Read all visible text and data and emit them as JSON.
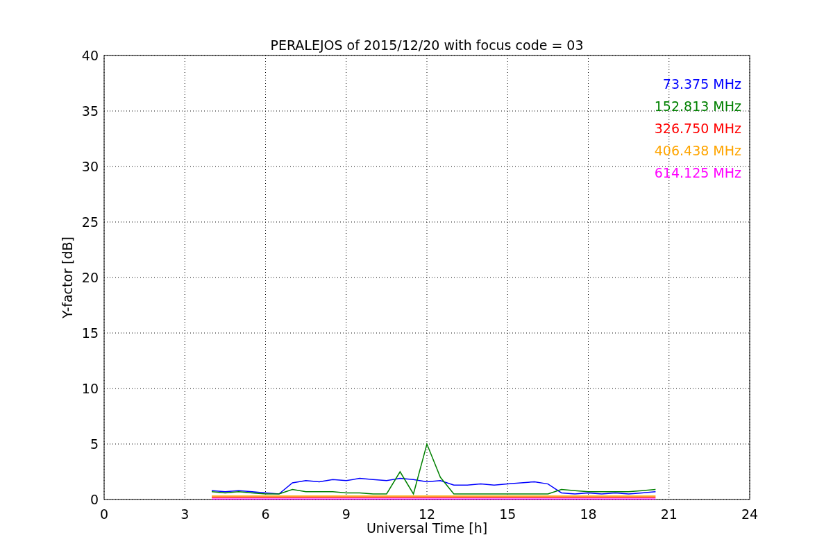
{
  "chart_data": {
    "type": "line",
    "grid": true,
    "title": "PERALEJOS of 2015/12/20 with focus code = 03",
    "xlabel": "Universal Time [h]",
    "ylabel": "Y-factor [dB]",
    "x": [
      4,
      4.5,
      5,
      5.5,
      6,
      6.5,
      7,
      7.5,
      8,
      8.5,
      9,
      9.5,
      10,
      10.5,
      11,
      11.5,
      12,
      12.5,
      13,
      13.5,
      14,
      14.5,
      15,
      15.5,
      16,
      16.5,
      17,
      17.5,
      18,
      18.5,
      19,
      19.5,
      20,
      20.5
    ],
    "series": [
      {
        "name": "73.375 MHz",
        "color": "#0000ff",
        "values": [
          0.8,
          0.7,
          0.8,
          0.7,
          0.6,
          0.5,
          1.5,
          1.7,
          1.6,
          1.8,
          1.7,
          1.9,
          1.8,
          1.7,
          1.9,
          1.8,
          1.6,
          1.7,
          1.3,
          1.3,
          1.4,
          1.3,
          1.4,
          1.5,
          1.6,
          1.4,
          0.6,
          0.5,
          0.6,
          0.5,
          0.6,
          0.5,
          0.6,
          0.7
        ]
      },
      {
        "name": "152.813 MHz",
        "color": "#008000",
        "values": [
          0.7,
          0.6,
          0.7,
          0.6,
          0.5,
          0.5,
          0.9,
          0.7,
          0.7,
          0.7,
          0.6,
          0.6,
          0.5,
          0.5,
          2.5,
          0.5,
          5.0,
          2.0,
          0.5,
          0.5,
          0.5,
          0.5,
          0.5,
          0.5,
          0.5,
          0.5,
          0.9,
          0.8,
          0.7,
          0.7,
          0.7,
          0.7,
          0.8,
          0.9
        ]
      },
      {
        "name": "326.750 MHz",
        "color": "#ff0000",
        "values": [
          0.2,
          0.2,
          0.2,
          0.2,
          0.2,
          0.2,
          0.2,
          0.2,
          0.2,
          0.2,
          0.2,
          0.2,
          0.2,
          0.2,
          0.2,
          0.2,
          0.2,
          0.2,
          0.2,
          0.2,
          0.2,
          0.2,
          0.2,
          0.2,
          0.2,
          0.2,
          0.2,
          0.2,
          0.2,
          0.2,
          0.2,
          0.2,
          0.2,
          0.2
        ]
      },
      {
        "name": "406.438 MHz",
        "color": "#ffa500",
        "values": [
          0.32,
          0.32,
          0.32,
          0.32,
          0.32,
          0.32,
          0.32,
          0.32,
          0.32,
          0.32,
          0.32,
          0.32,
          0.32,
          0.32,
          0.32,
          0.32,
          0.32,
          0.32,
          0.32,
          0.32,
          0.32,
          0.32,
          0.32,
          0.32,
          0.32,
          0.32,
          0.32,
          0.32,
          0.32,
          0.32,
          0.32,
          0.32,
          0.32,
          0.32
        ]
      },
      {
        "name": "614.125 MHz",
        "color": "#ff00ff",
        "values": [
          0.05,
          0.05,
          0.05,
          0.05,
          0.05,
          0.05,
          0.05,
          0.05,
          0.05,
          0.05,
          0.05,
          0.05,
          0.05,
          0.05,
          0.05,
          0.05,
          0.05,
          0.05,
          0.05,
          0.05,
          0.05,
          0.05,
          0.05,
          0.05,
          0.05,
          0.05,
          0.05,
          0.05,
          0.05,
          0.05,
          0.05,
          0.05,
          0.05,
          0.05
        ]
      }
    ],
    "xlim": [
      0,
      24
    ],
    "ylim": [
      0,
      40
    ],
    "xticks": [
      0,
      3,
      6,
      9,
      12,
      15,
      18,
      21,
      24
    ],
    "yticks": [
      0,
      5,
      10,
      15,
      20,
      25,
      30,
      35,
      40
    ]
  }
}
